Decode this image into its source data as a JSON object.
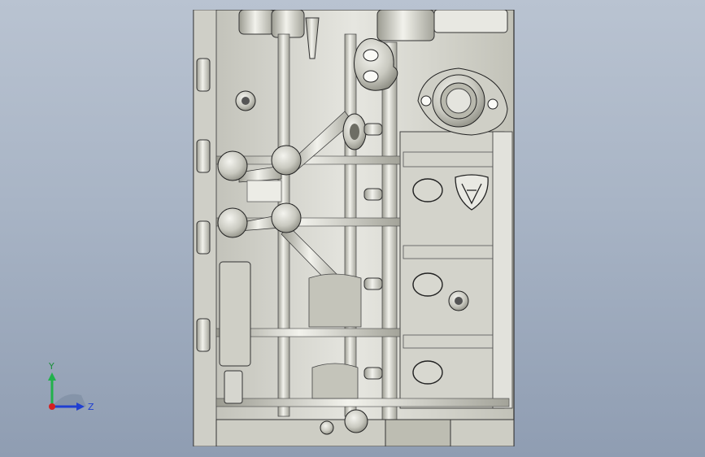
{
  "viewport": {
    "background_top": "#b9c3d1",
    "background_bottom": "#8f9db2"
  },
  "model": {
    "icon": "engine-block-part",
    "body_color": "#d9d9d2",
    "shadow_color": "#a7a79c",
    "line_color": "#2a2a2a"
  },
  "triad": {
    "y_label": "Y",
    "z_label": "Z",
    "y_color": "#22b14c",
    "z_color": "#1f3fd1",
    "x_color": "#d42020"
  }
}
